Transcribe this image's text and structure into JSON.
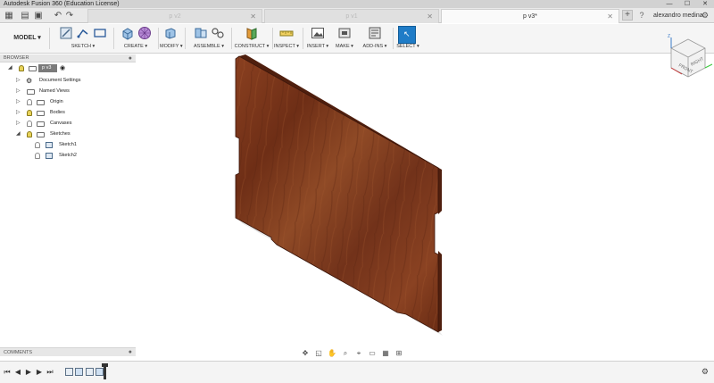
{
  "title": "Autodesk Fusion 360 (Education License)",
  "window_controls": [
    "—",
    "☐",
    "✕"
  ],
  "tabs": [
    {
      "label": "p v2",
      "active": false
    },
    {
      "label": "p v1",
      "active": false
    },
    {
      "label": "p v3*",
      "active": true
    }
  ],
  "user": "alexandro medina",
  "toolbar": {
    "workspace": "MODEL ▾",
    "groups": [
      "SKETCH ▾",
      "CREATE ▾",
      "MODIFY ▾",
      "ASSEMBLE ▾",
      "CONSTRUCT ▾",
      "INSPECT ▾",
      "INSERT ▾",
      "MAKE ▾",
      "ADD-INS ▾",
      "SELECT ▾"
    ]
  },
  "browser": {
    "header": "BROWSER",
    "root": "p v3",
    "items": [
      "Document Settings",
      "Named Views",
      "Origin",
      "Bodies",
      "Canvases",
      "Sketches"
    ],
    "sketches": [
      "Sketch1",
      "Sketch2"
    ]
  },
  "comments": {
    "header": "COMMENTS"
  },
  "colors": {
    "wood": "#7a351c",
    "accent": "#1f7cc7",
    "highlight": "#7a7a7a"
  }
}
